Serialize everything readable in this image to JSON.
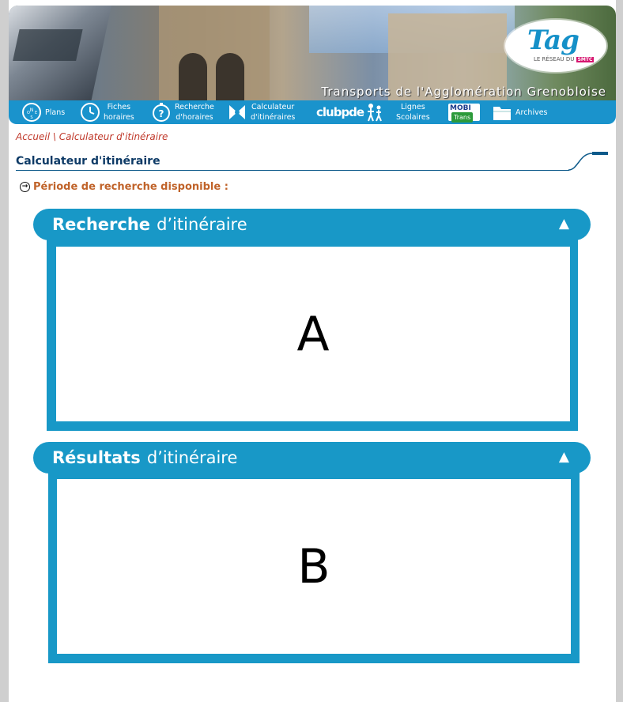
{
  "banner": {
    "title": "Transports de l'Agglomération Grenobloise",
    "logo_word": "Tag",
    "logo_sub": "LE RÉSEAU DU",
    "logo_badge": "SMTC"
  },
  "nav": {
    "items": [
      {
        "icon": "map-compass-icon",
        "label_l1": "Plans",
        "label_l2": ""
      },
      {
        "icon": "clock-icon",
        "label_l1": "Fiches",
        "label_l2": "horaires"
      },
      {
        "icon": "question-clock-icon",
        "label_l1": "Recherche",
        "label_l2": "d'horaires"
      },
      {
        "icon": "route-arrows-icon",
        "label_l1": "Calculateur",
        "label_l2": "d'itinéraires"
      },
      {
        "icon": "clubpde-logo",
        "label_l1": "clubpde",
        "label_l2": ""
      },
      {
        "icon": "children-walking-icon",
        "label_l1": "Lignes",
        "label_l2": "Scolaires"
      },
      {
        "icon": "mobitrans-logo",
        "label_l1": "MOBI",
        "label_l2": "Trans"
      },
      {
        "icon": "folder-icon",
        "label_l1": "Archives",
        "label_l2": ""
      }
    ]
  },
  "breadcrumb": {
    "home": "Accueil",
    "separator": "\\",
    "current": "Calculateur d'itinéraire"
  },
  "page": {
    "heading": "Calculateur d'itinéraire",
    "period_label": "Période de recherche disponible :"
  },
  "panels": {
    "search": {
      "bold": "Recherche",
      "light": "d’itinéraire",
      "arrow": "▲",
      "placeholder": "A"
    },
    "results": {
      "bold": "Résultats",
      "light": "d’itinéraire",
      "arrow": "▲",
      "placeholder": "B"
    }
  },
  "colors": {
    "accent": "#1898c7",
    "nav": "#1a93cc",
    "breadcrumb": "#c0392b",
    "heading": "#0d3a66",
    "period": "#c0632a"
  }
}
